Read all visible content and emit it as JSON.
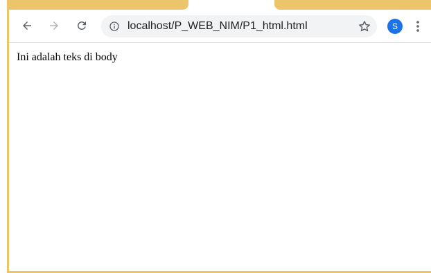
{
  "toolbar": {
    "back_icon": "arrow-left-icon",
    "forward_icon": "arrow-right-icon",
    "reload_icon": "reload-icon",
    "address": {
      "info_icon": "info-icon",
      "url": "localhost/P_WEB_NIM/P1_html.html",
      "bookmark_icon": "star-icon"
    },
    "profile_initial": "S",
    "menu_icon": "kebab-menu-icon"
  },
  "page": {
    "body_text": "Ini adalah teks di body"
  },
  "colors": {
    "frame_accent": "#ecc56b",
    "omnibox_bg": "#f1f3f4",
    "profile_bg": "#1a73e8",
    "icon_gray": "#5f6368"
  }
}
